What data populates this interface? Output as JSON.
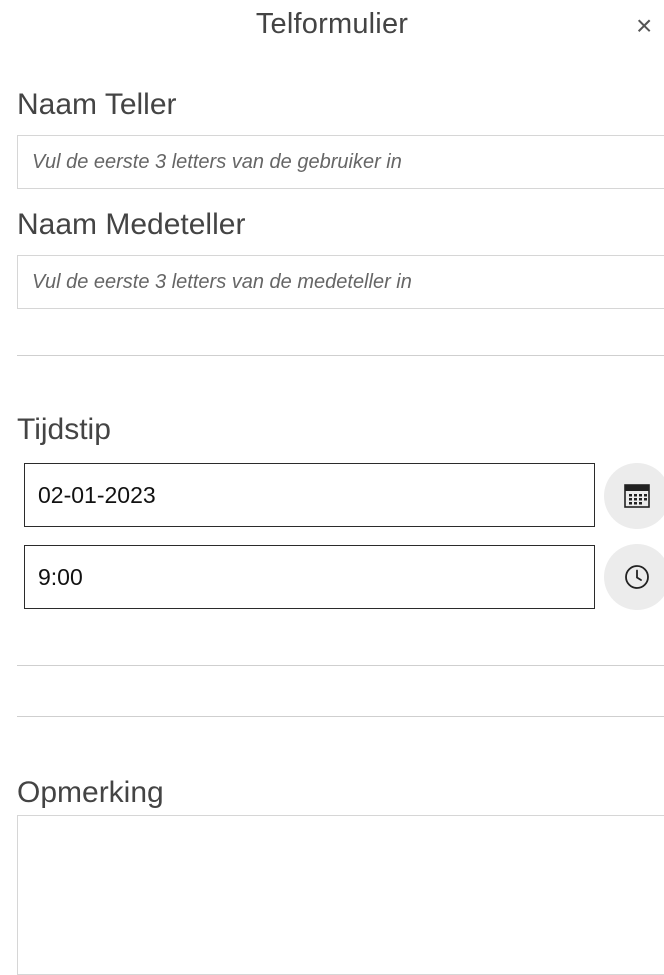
{
  "dialog": {
    "title": "Telformulier",
    "close_glyph": "×"
  },
  "naam_teller": {
    "label": "Naam Teller",
    "placeholder": "Vul de eerste 3 letters van de gebruiker in",
    "value": ""
  },
  "naam_medeteller": {
    "label": "Naam Medeteller",
    "placeholder": "Vul de eerste 3 letters van de medeteller in",
    "value": ""
  },
  "tijdstip": {
    "label": "Tijdstip",
    "date_value": "02-01-2023",
    "time_value": "9:00",
    "date_button_icon": "calendar-icon",
    "time_button_icon": "clock-icon"
  },
  "opmerking": {
    "label": "Opmerking",
    "value": ""
  }
}
